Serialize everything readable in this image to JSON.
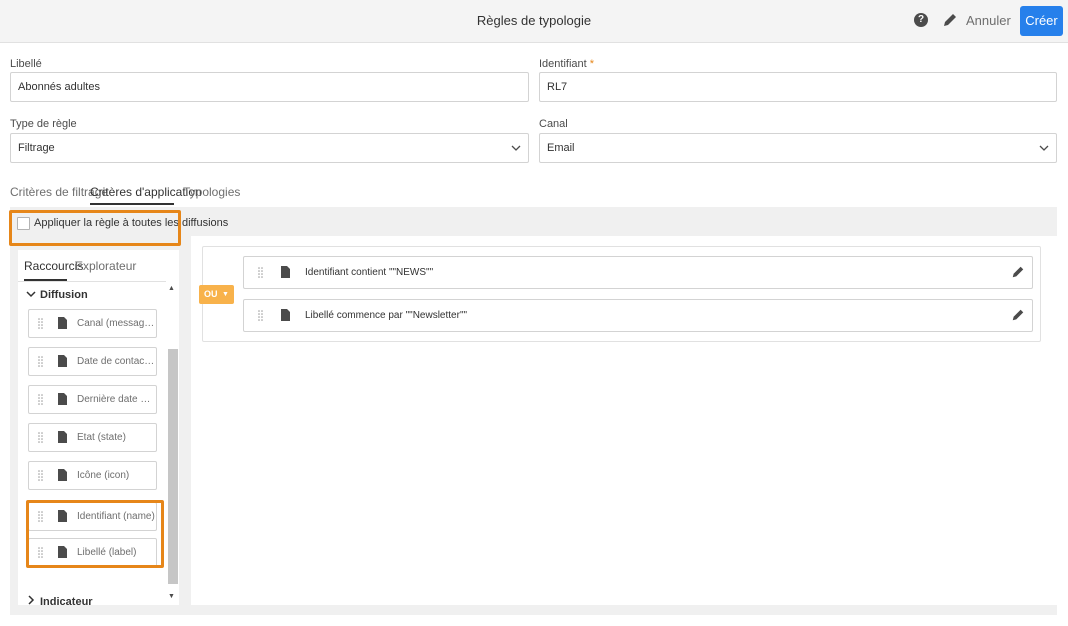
{
  "header": {
    "title": "Règles de typologie",
    "help_icon": "help-icon",
    "help_glyph": "?",
    "edit_icon": "pencil-icon",
    "cancel_label": "Annuler",
    "create_label": "Créer"
  },
  "form": {
    "libelle_label": "Libellé",
    "libelle_value": "Abonnés adultes",
    "identifiant_label": "Identifiant",
    "identifiant_required": "*",
    "identifiant_value": "RL7",
    "type_label": "Type de règle",
    "type_value": "Filtrage",
    "canal_label": "Canal",
    "canal_value": "Email"
  },
  "tabs": [
    {
      "label": "Critères de filtrage",
      "active": false
    },
    {
      "label": "Critères d'application",
      "active": true
    },
    {
      "label": "Typologies",
      "active": false
    }
  ],
  "apply_all_label": "Appliquer la règle à toutes les diffusions",
  "apply_all_checked": false,
  "left_panel": {
    "tabs": [
      {
        "label": "Raccourcis",
        "active": true
      },
      {
        "label": "Explorateur",
        "active": false
      }
    ],
    "groups": [
      {
        "label": "Diffusion",
        "expanded": true
      },
      {
        "label": "Indicateur",
        "expanded": false
      }
    ],
    "items": [
      {
        "label": "Canal (messageTyp..."
      },
      {
        "label": "Date de contact (co..."
      },
      {
        "label": "Dernière date de co..."
      },
      {
        "label": "Etat (state)"
      },
      {
        "label": "Icône (icon)"
      },
      {
        "label": "Identifiant (name)"
      },
      {
        "label": "Libellé (label)"
      }
    ]
  },
  "operator": {
    "label": "OU",
    "color": "#f8b24b"
  },
  "rules": [
    {
      "text": "Identifiant contient \"\"NEWS\"\""
    },
    {
      "text": "Libellé commence par \"\"Newsletter\"\""
    }
  ],
  "colors": {
    "accent": "#2680eb",
    "highlight": "#e68619",
    "operator": "#f8b24b"
  }
}
